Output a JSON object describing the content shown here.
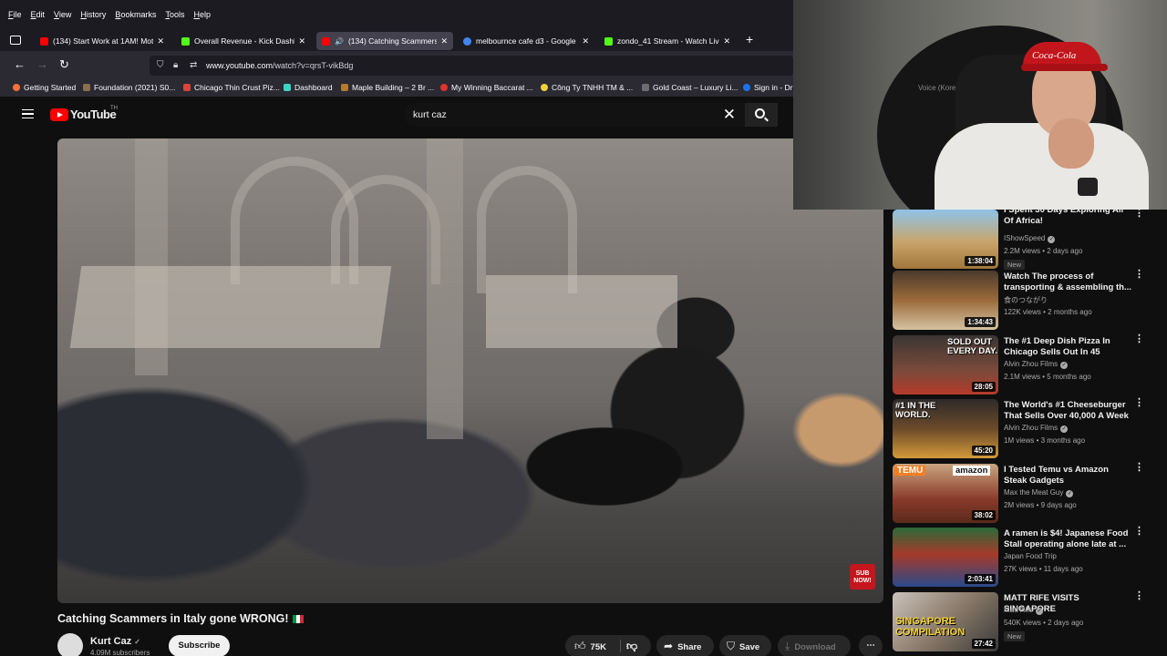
{
  "menubar": [
    "File",
    "Edit",
    "View",
    "History",
    "Bookmarks",
    "Tools",
    "Help"
  ],
  "tabs": [
    {
      "title": "(134) Start Work at 1AM! Moth",
      "favicon": "youtube",
      "color": "#ff0000"
    },
    {
      "title": "Overall Revenue - Kick Dashbo",
      "favicon": "kick",
      "color": "#53fc18"
    },
    {
      "title": "(134) Catching Scammers i",
      "favicon": "youtube",
      "color": "#ff0000",
      "active": true
    },
    {
      "title": "melbournce cafe d3 - Google S",
      "favicon": "google",
      "color": "#4285f4"
    },
    {
      "title": "zondo_41 Stream - Watch Live o",
      "favicon": "kick",
      "color": "#53fc18"
    }
  ],
  "nav": {
    "url_host": "www.youtube.com",
    "url_path": "/watch?v=qrsT-vikBdg"
  },
  "bookmarks": [
    {
      "label": "Getting Started",
      "color": "#ff7139"
    },
    {
      "label": "Foundation (2021) S0...",
      "color": "#8a6f4d"
    },
    {
      "label": "Chicago Thin Crust Piz...",
      "color": "#d9453b"
    },
    {
      "label": "Dashboard",
      "color": "#3bd4c4"
    },
    {
      "label": "Maple Building – 2 Br ...",
      "color": "#b37a2c"
    },
    {
      "label": "My Winning Baccarat ...",
      "color": "#e0332c"
    },
    {
      "label": "Công Ty TNHH TM & ...",
      "color": "#f2d03b"
    },
    {
      "label": "Gold Coast – Luxury Li...",
      "color": "#6d6d6d"
    },
    {
      "label": "Sign in - Dr",
      "color": "#1a73e8"
    }
  ],
  "yt": {
    "wordmark": "YouTube",
    "country": "TH",
    "search_value": "kurt caz"
  },
  "video": {
    "title": "Catching Scammers in Italy gone WRONG!",
    "sub_now_label": "SUB NOW!",
    "channel": "Kurt Caz",
    "subscribers": "4.09M subscribers",
    "subscribe_label": "Subscribe",
    "likes": "75K",
    "share_label": "Share",
    "save_label": "Save",
    "download_label": "Download"
  },
  "webcam": {
    "cap_logo": "Coca-Cola",
    "ghost_text": "Voice (Korean Dra"
  },
  "recs": [
    {
      "title": "I Spent 30 Days Exploring All Of Africa!",
      "channel": "IShowSpeed",
      "verified": true,
      "views": "2.2M views",
      "age": "2 days ago",
      "duration": "1:38:04",
      "badge": "New",
      "thumb": "linear-gradient(180deg,#8ec3e8 0%,#c9a46a 55%,#a0763c 100%)"
    },
    {
      "title": "Watch The process of transporting & assembling th...",
      "channel": "食のつながり",
      "verified": false,
      "views": "122K views",
      "age": "2 months ago",
      "duration": "1:34:43",
      "badge": "",
      "thumb": "linear-gradient(180deg,#4a3b2e 0%,#9a6a3a 50%,#d5c3a3 100%)"
    },
    {
      "title": "The #1 Deep Dish Pizza In Chicago Sells Out In 45 Minutes",
      "channel": "Alvin Zhou Films",
      "verified": true,
      "views": "2.1M views",
      "age": "5 months ago",
      "duration": "28:05",
      "badge": "",
      "caption": "SOLD OUT EVERY DAY.",
      "thumb": "linear-gradient(180deg,#3a3533 0%,#7a4a3a 60%,#b53a2a 100%)"
    },
    {
      "title": "The World's #1 Cheeseburger That Sells Over 40,000 A Week",
      "channel": "Alvin Zhou Films",
      "verified": true,
      "views": "1M views",
      "age": "3 months ago",
      "duration": "45:20",
      "badge": "",
      "caption": "#1 IN THE WORLD.",
      "thumb": "linear-gradient(180deg,#2d2a2a 0%,#6b4a2a 50%,#d49a3a 100%)"
    },
    {
      "title": "I Tested Temu vs Amazon Steak Gadgets",
      "channel": "Max the Meat Guy",
      "verified": true,
      "views": "2M views",
      "age": "9 days ago",
      "duration": "38:02",
      "badge": "",
      "temu": "TEMU",
      "amazon": "amazon",
      "thumb": "linear-gradient(180deg,#c9a580 0%,#8a3a2a 60%,#5a2a1a 100%)"
    },
    {
      "title": "A ramen is $4! Japanese Food Stall operating alone late at ...",
      "channel": "Japan Food Trip",
      "verified": false,
      "views": "27K views",
      "age": "11 days ago",
      "duration": "2:03:41",
      "badge": "",
      "thumb": "linear-gradient(180deg,#2a6a3a 0%,#a53a2a 45%,#2a4a8a 100%)"
    },
    {
      "title": "MATT RIFE VISITS SINGAPORE",
      "channel": "Matt Rife",
      "verified": true,
      "views": "540K views",
      "age": "2 days ago",
      "duration": "27:42",
      "badge": "New",
      "caption": "SINGAPORE COMPILATION",
      "thumb": "linear-gradient(135deg,#c9c2bb 0%,#8a7a6a 50%,#3a3a3a 100%)"
    }
  ]
}
